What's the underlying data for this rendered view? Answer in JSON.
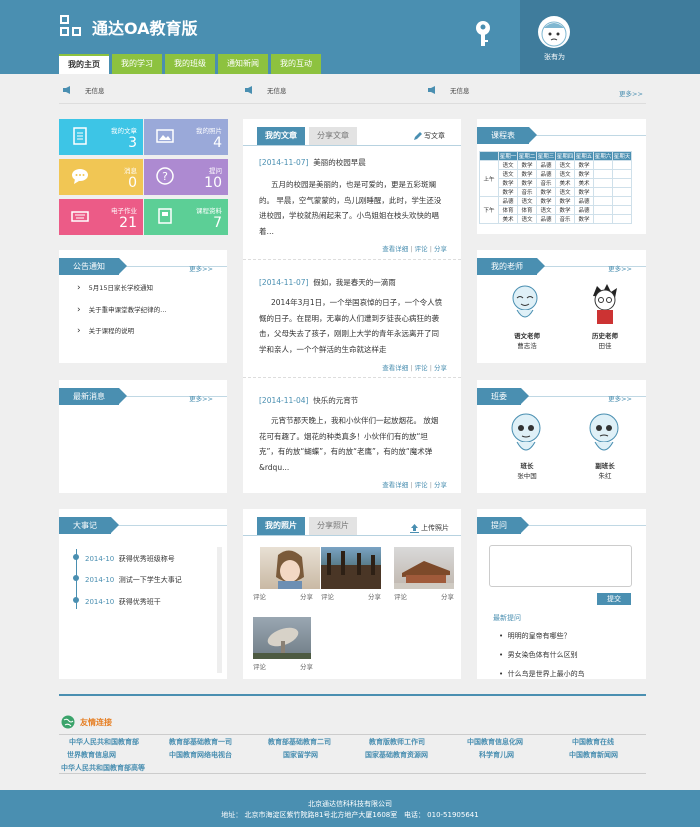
{
  "header": {
    "title": "通达OA教育版",
    "user_name": "张有为"
  },
  "nav": [
    "我的主页",
    "我的学习",
    "我的班级",
    "通知新闻",
    "我的互动"
  ],
  "notices": [
    "无信息",
    "无信息",
    "无信息"
  ],
  "more_label": "更多>>",
  "tiles": [
    {
      "label": "我的文章",
      "value": "3",
      "color": "#3dc5e6",
      "icon": "document-icon"
    },
    {
      "label": "我的照片",
      "value": "4",
      "color": "#9aa9d9",
      "icon": "picture-icon"
    },
    {
      "label": "消息",
      "value": "0",
      "color": "#f1c654",
      "icon": "chat-icon"
    },
    {
      "label": "提问",
      "value": "10",
      "color": "#ad8ad1",
      "icon": "question-icon"
    },
    {
      "label": "电子作业",
      "value": "21",
      "color": "#ec5b87",
      "icon": "keyboard-icon"
    },
    {
      "label": "课程资料",
      "value": "7",
      "color": "#5ccf96",
      "icon": "book-icon"
    }
  ],
  "announcements": {
    "title": "公告通知",
    "items": [
      "5月15日家长学校通知",
      "关于重申课堂教学纪律的…",
      "关于课程的说明"
    ]
  },
  "latest": {
    "title": "最新消息"
  },
  "events": {
    "title": "大事记",
    "items": [
      {
        "date": "2014-10",
        "text": "获得优秀班级称号"
      },
      {
        "date": "2014-10",
        "text": "测试一下学生大事记"
      },
      {
        "date": "2014-10",
        "text": "获得优秀班干"
      }
    ]
  },
  "articles": {
    "tab_mine": "我的文章",
    "tab_share": "分享文章",
    "write": "写文章",
    "items": [
      {
        "date": "[2014-11-07]",
        "title": "美丽的校园早晨",
        "body": "五月的校园是美丽的，也是可爱的，更是五彩斑斓的。 早晨，空气蒙蒙的，鸟儿刚睡醒，此时，学生还没进校园，学校就热闹起来了。小鸟姐姐在枝头欢快的唱着…"
      },
      {
        "date": "[2014-11-07]",
        "title": "假如，我是春天的一滴雨",
        "body": "2014年3月1日，一个举国哀悼的日子，一个令人愤慨的日子。在昆明，无辜的人们遭到歹徒丧心病狂的袭击，父母失去了孩子，刚刚上大学的青年永远离开了同学和亲人，一个个鲜活的生命就这样走"
      },
      {
        "date": "[2014-11-04]",
        "title": "快乐的元宵节",
        "body": "元宵节那天晚上，我和小伙伴们一起放烟花。 放烟花可有趣了。烟花的种类真多！小伙伴们有的放“坦克”，有的放“蝴蝶”，有的放“老鹰”，有的放“魔术弹&rdqu..."
      }
    ],
    "foot_detail": "查看详细",
    "foot_comment": "评论",
    "foot_share": "分享"
  },
  "timetable": {
    "title": "课程表",
    "headers": [
      "",
      "星期一",
      "星期二",
      "星期三",
      "星期四",
      "星期五",
      "星期六",
      "星期天"
    ],
    "am_label": "上午",
    "pm_label": "下午",
    "am": [
      [
        "语文",
        "数学",
        "品德",
        "语文",
        "数学"
      ],
      [
        "语文",
        "数学",
        "品德",
        "语文",
        "数学"
      ],
      [
        "数学",
        "数学",
        "音乐",
        "美术",
        "美术"
      ],
      [
        "数学",
        "音乐",
        "数学",
        "语文",
        "数学"
      ]
    ],
    "pm": [
      [
        "品德",
        "语文",
        "数学",
        "数学",
        "品德"
      ],
      [
        "体育",
        "体育",
        "语文",
        "数学",
        "品德"
      ],
      [
        "美术",
        "语文",
        "品德",
        "音乐",
        "数学"
      ]
    ]
  },
  "teachers": {
    "title": "我的老师",
    "items": [
      {
        "role": "语文老师",
        "name": "曹志浩"
      },
      {
        "role": "历史老师",
        "name": "田佳"
      }
    ]
  },
  "committee": {
    "title": "班委",
    "items": [
      {
        "role": "班长",
        "name": "张中国"
      },
      {
        "role": "副班长",
        "name": "朱红"
      }
    ]
  },
  "photos": {
    "tab_mine": "我的照片",
    "tab_share": "分享照片",
    "upload": "上传照片",
    "comment": "评论",
    "share": "分享"
  },
  "questions": {
    "title": "提问",
    "submit": "提交",
    "latest_label": "最新提问",
    "items": [
      "明明的皇帝有哪些？",
      "男女染色体有什么区别",
      "什么鸟是世界上最小的鸟"
    ]
  },
  "links": {
    "title": "友情连接",
    "items": [
      "中华人民共和国教育部",
      "教育部基础教育一司",
      "教育部基础教育二司",
      "教育版教师工作司",
      "中国教育信息化网",
      "中国教育在线",
      "世界教育信息网",
      "中国教育网络电视台",
      "国家留学网",
      "国家基础教育资源网",
      "科学育儿网",
      "中国教育新闻网",
      "中华人民共和国教育部高等"
    ]
  },
  "footer": {
    "company": "北京通达信科科技有限公司",
    "address": "地址： 北京市海淀区紫竹院路81号北方地产大厦1608室",
    "phone": "电话： 010-51905641"
  }
}
